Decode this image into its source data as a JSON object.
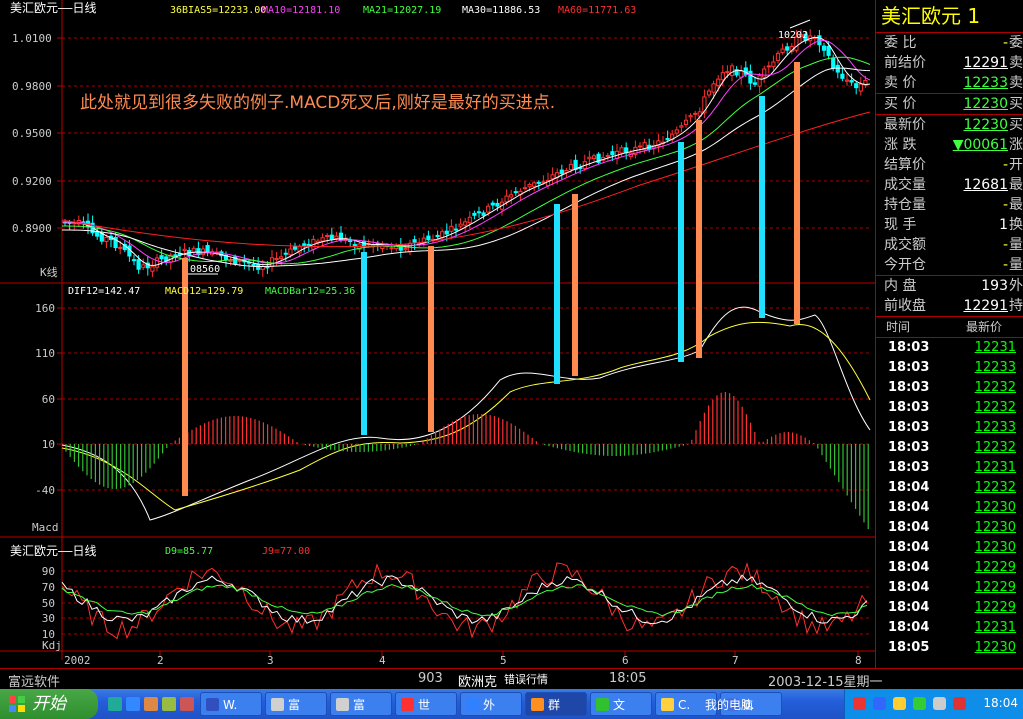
{
  "colors": {
    "up": "#ff3030",
    "down": "#00ffff",
    "ma5": "#ffffff",
    "ma10": "#ff40ff",
    "ma21": "#40ff40",
    "ma30": "#ffffff",
    "ma60": "#ff2020",
    "dif": "#ffffff",
    "dea": "#ffff40",
    "annotation": "#ff8a50",
    "mark_cyan": "#20e0ff",
    "mark_orange": "#ff8a50"
  },
  "main_panel": {
    "indicators": [
      {
        "text": "36BIAS5=12233.00",
        "color": "#ffff40"
      },
      {
        "text": "MA10=12181.10",
        "color": "#ff40ff"
      },
      {
        "text": "MA21=12027.19",
        "color": "#40ff40"
      },
      {
        "text": "MA30=11886.53",
        "color": "#ffffff"
      },
      {
        "text": "MA60=11771.63",
        "color": "#ff3030"
      }
    ],
    "title": "美汇欧元——日线",
    "y_ticks": [
      "1.0100",
      "0.9800",
      "0.9500",
      "0.9200",
      "0.8900"
    ],
    "label": "K线",
    "low_label": "08560",
    "high_label": "10202",
    "annotation": "此处就见到很多失败的例子.MACD死叉后,刚好是最好的买进点."
  },
  "macd_panel": {
    "indicators": [
      {
        "text": "DIF12=142.47",
        "color": "#ffffff"
      },
      {
        "text": "MACD12=129.79",
        "color": "#ffff40"
      },
      {
        "text": "MACDBar12=25.36",
        "color": "#40ff40"
      }
    ],
    "y_ticks": [
      "160",
      "110",
      "60",
      "10",
      "-40"
    ],
    "label": "Macd"
  },
  "kdj_panel": {
    "title": "美汇欧元——日线",
    "indicators": [
      {
        "text": "D9=85.77",
        "color": "#40ff40"
      },
      {
        "text": "J9=77.00",
        "color": "#ff3030"
      }
    ],
    "y_ticks": [
      "90",
      "70",
      "50",
      "30",
      "10"
    ],
    "label": "Kdj"
  },
  "x_axis": [
    "2002",
    "2",
    "3",
    "4",
    "5",
    "6",
    "7",
    "8"
  ],
  "quote": {
    "title": "美汇欧元 1",
    "rows": [
      {
        "label": "委  比",
        "value": "-",
        "suffix": "委",
        "value_color": "#ffff40"
      },
      {
        "label": "前结价",
        "value": "12291",
        "suffix": "卖",
        "value_color": "#ffffff"
      },
      {
        "label": "卖  价",
        "value": "12233",
        "suffix": "卖",
        "value_color": "#40ff40",
        "sep": true
      },
      {
        "label": "买  价",
        "value": "12230",
        "suffix": "买",
        "value_color": "#40ff40",
        "sep": true
      },
      {
        "label": "最新价",
        "value": "12230",
        "suffix": "买",
        "value_color": "#40ff40"
      },
      {
        "label": "涨  跌",
        "value": "▼00061",
        "suffix": "涨",
        "value_color": "#40ff40"
      },
      {
        "label": "结算价",
        "value": "-",
        "suffix": "开",
        "value_color": "#ffff40"
      },
      {
        "label": "成交量",
        "value": "12681",
        "suffix": "最",
        "value_color": "#ffffff"
      },
      {
        "label": "持仓量",
        "value": "-",
        "suffix": "最",
        "value_color": "#ffff40"
      },
      {
        "label": "现  手",
        "value": "1",
        "suffix": "换",
        "value_color": "#ffffff"
      },
      {
        "label": "成交额",
        "value": "-",
        "suffix": "量",
        "value_color": "#ffff40"
      },
      {
        "label": "今开仓",
        "value": "-",
        "suffix": "量",
        "value_color": "#ffff40",
        "sep": true
      },
      {
        "label": "内  盘",
        "value": "193",
        "suffix": "外",
        "value_color": "#ffffff"
      },
      {
        "label": "前收盘",
        "value": "12291",
        "suffix": "持",
        "value_color": "#ffffff",
        "sep": true
      }
    ],
    "table_header": {
      "time": "时间",
      "price": "最新价"
    },
    "ticks": [
      {
        "time": "18:03",
        "price": "12231"
      },
      {
        "time": "18:03",
        "price": "12233"
      },
      {
        "time": "18:03",
        "price": "12232"
      },
      {
        "time": "18:03",
        "price": "12232"
      },
      {
        "time": "18:03",
        "price": "12233"
      },
      {
        "time": "18:03",
        "price": "12232"
      },
      {
        "time": "18:03",
        "price": "12231"
      },
      {
        "time": "18:04",
        "price": "12232"
      },
      {
        "time": "18:04",
        "price": "12230"
      },
      {
        "time": "18:04",
        "price": "12230"
      },
      {
        "time": "18:04",
        "price": "12230"
      },
      {
        "time": "18:04",
        "price": "12229"
      },
      {
        "time": "18:04",
        "price": "12229"
      },
      {
        "time": "18:04",
        "price": "12229"
      },
      {
        "time": "18:04",
        "price": "12231"
      },
      {
        "time": "18:05",
        "price": "12230"
      }
    ]
  },
  "status_bar": {
    "vendor": "富远软件",
    "code": "903",
    "news": "欧洲克",
    "tip": "错误行情",
    "time": "18:05",
    "date": "2003-12-15星期一"
  },
  "taskbar": {
    "start": "开始",
    "tasks": [
      {
        "label": "W.",
        "icon_color": "#3050c0"
      },
      {
        "label": "富",
        "icon_color": "#d0d0d0"
      },
      {
        "label": "富",
        "icon_color": "#d0d0d0"
      },
      {
        "label": "世",
        "icon_color": "#ff3030"
      },
      {
        "label": "外",
        "icon_color": "#3080ff"
      },
      {
        "label": "群",
        "icon_color": "#ff9020"
      },
      {
        "label": "文",
        "icon_color": "#30c030"
      },
      {
        "label": "C.",
        "icon_color": "#ffd040"
      },
      {
        "label": "0.",
        "icon_color": "#4070e0"
      }
    ],
    "tray_label": "我的电脑",
    "clock": "18:04"
  }
}
